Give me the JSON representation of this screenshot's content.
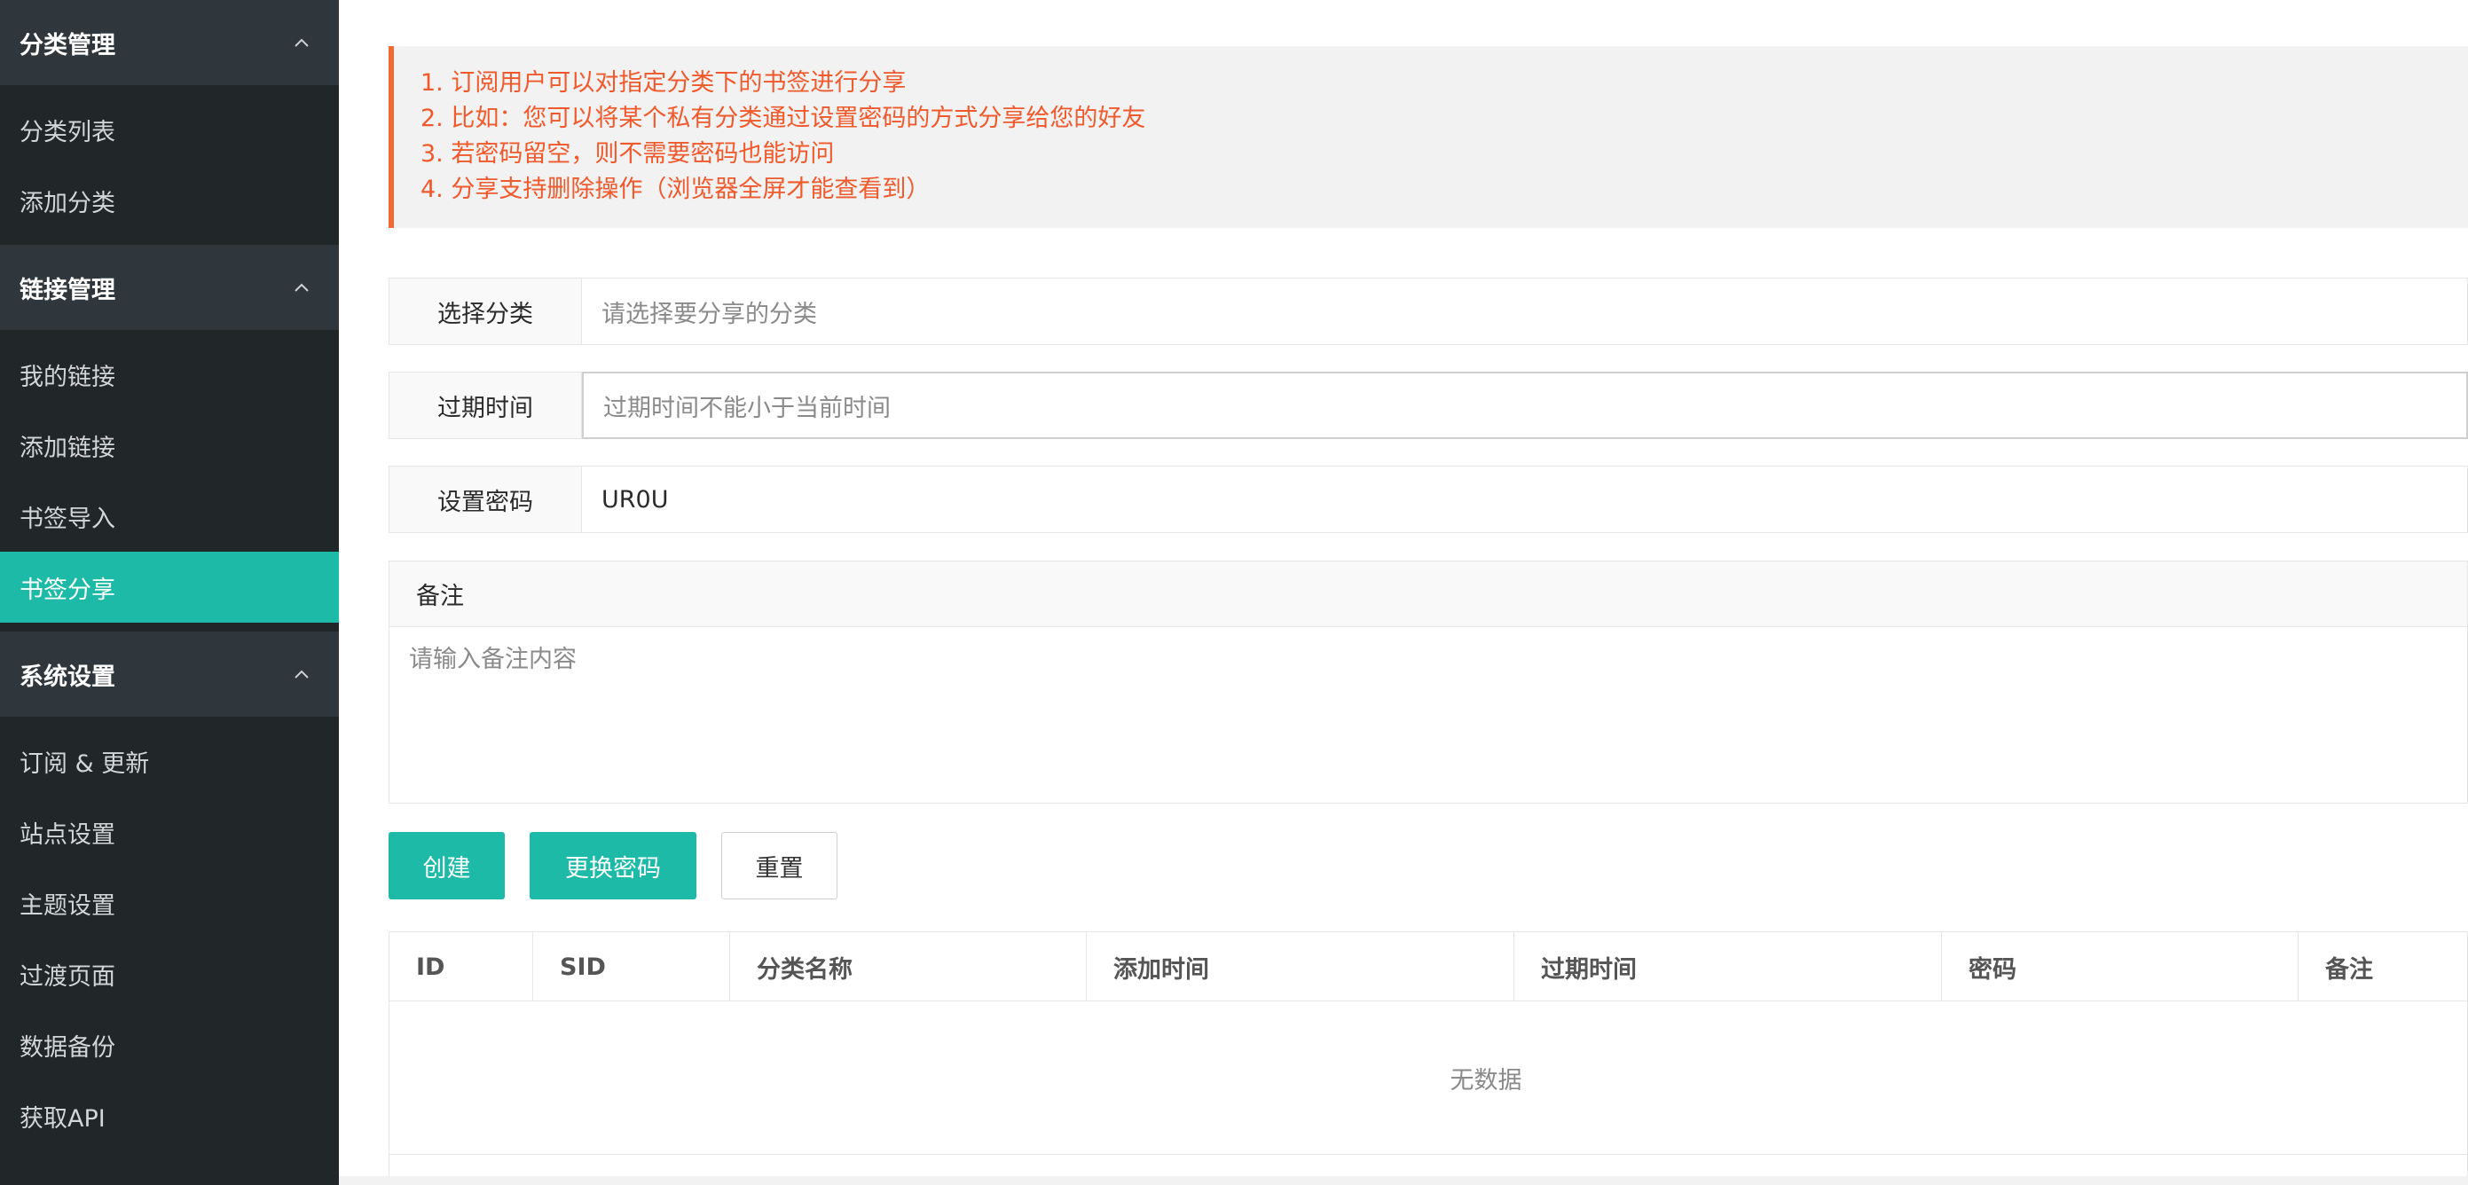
{
  "sidebar": {
    "groups": [
      {
        "title": "分类管理",
        "items": [
          "分类列表",
          "添加分类"
        ]
      },
      {
        "title": "链接管理",
        "items": [
          "我的链接",
          "添加链接",
          "书签导入",
          "书签分享"
        ]
      },
      {
        "title": "系统设置",
        "items": [
          "订阅 & 更新",
          "站点设置",
          "主题设置",
          "过渡页面",
          "数据备份",
          "获取API"
        ]
      }
    ],
    "active_item": "书签分享",
    "active_color": "#1ebaa8"
  },
  "notice": {
    "lines": [
      "1. 订阅用户可以对指定分类下的书签进行分享",
      "2. 比如：您可以将某个私有分类通过设置密码的方式分享给您的好友",
      "3. 若密码留空，则不需要密码也能访问",
      "4. 分享支持删除操作（浏览器全屏才能查看到）"
    ],
    "accent": "#f06b34"
  },
  "form": {
    "category": {
      "label": "选择分类",
      "placeholder": "请选择要分享的分类"
    },
    "expire": {
      "label": "过期时间",
      "placeholder": "过期时间不能小于当前时间"
    },
    "password": {
      "label": "设置密码",
      "value": "UR0U"
    },
    "remark": {
      "label": "备注",
      "placeholder": "请输入备注内容"
    }
  },
  "buttons": {
    "create": "创建",
    "change_password": "更换密码",
    "reset": "重置"
  },
  "table": {
    "columns": [
      "ID",
      "SID",
      "分类名称",
      "添加时间",
      "过期时间",
      "密码",
      "备注"
    ],
    "empty_text": "无数据"
  }
}
